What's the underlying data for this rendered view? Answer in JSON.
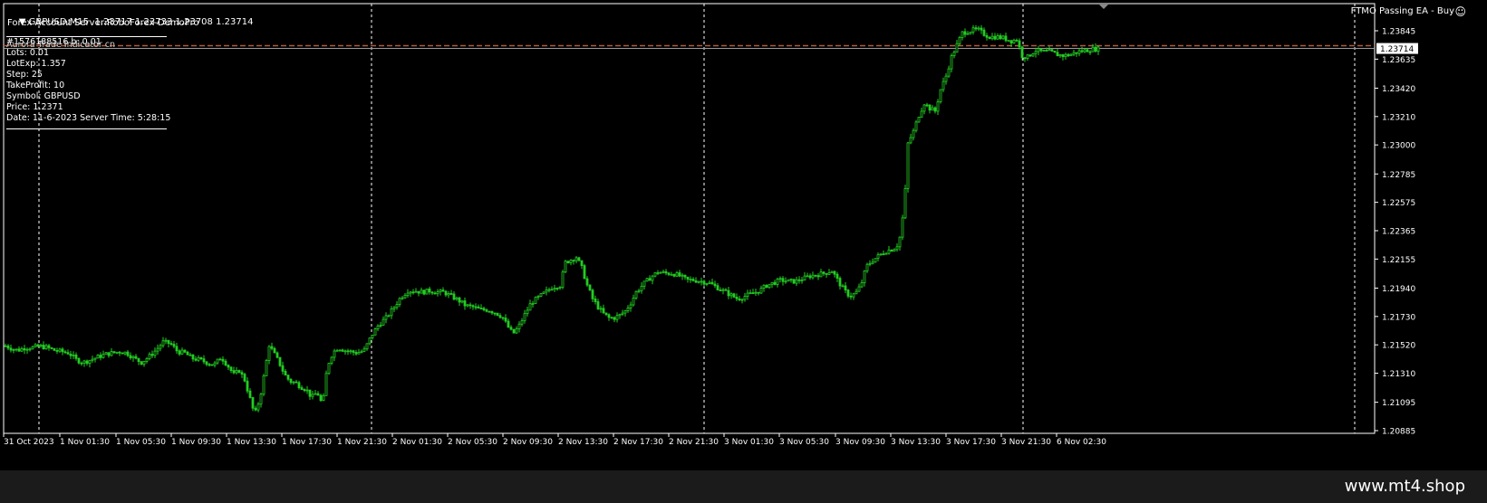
{
  "header": {
    "symbol_line": "GBPUSD,M15  1.23717 1.23733 1.23708 1.23714",
    "server_line": "Forex Account Server:RoboForex-DemoPro",
    "ea_name": "FTMO Passing EA - Buy",
    "ea_icon": "smiley-icon"
  },
  "info_panel": {
    "overlay_text": "#1576188516 b: 0.01",
    "overlay_text_2": "Aurora Trade Indicator cn",
    "lines": [
      "Lots:  0.01",
      "LotExp:  1.357",
      "Step: 25",
      "TakeProfit: 10",
      "Symbol: GBPUSD",
      "Price:  1.2371",
      "Date: 11-6-2023 Server Time: 5:28:15"
    ]
  },
  "watermark": "www.mt4.shop",
  "colors": {
    "background": "#000000",
    "candles": "#22cc22",
    "axis": "#ffffff",
    "grid": "#ffffff",
    "order_line": "#b05a3c"
  },
  "chart_data": {
    "type": "candlestick",
    "symbol": "GBPUSD",
    "timeframe": "M15",
    "current_price": "1.23714",
    "y_ticks": [
      "1.23845",
      "1.23635",
      "1.23420",
      "1.23210",
      "1.23000",
      "1.22785",
      "1.22575",
      "1.22365",
      "1.22155",
      "1.21940",
      "1.21730",
      "1.21520",
      "1.21310",
      "1.21095",
      "1.20885"
    ],
    "ylim": [
      1.20885,
      1.23845
    ],
    "x_ticks": [
      "31 Oct 2023",
      "1 Nov 01:30",
      "1 Nov 05:30",
      "1 Nov 09:30",
      "1 Nov 13:30",
      "1 Nov 17:30",
      "1 Nov 21:30",
      "2 Nov 01:30",
      "2 Nov 05:30",
      "2 Nov 09:30",
      "2 Nov 13:30",
      "2 Nov 17:30",
      "2 Nov 21:30",
      "3 Nov 01:30",
      "3 Nov 05:30",
      "3 Nov 09:30",
      "3 Nov 13:30",
      "3 Nov 17:30",
      "3 Nov 21:30",
      "6 Nov 02:30"
    ],
    "period_separators": 5,
    "close_path": [
      [
        0,
        1.2153
      ],
      [
        14,
        1.2149
      ],
      [
        20,
        1.2148
      ],
      [
        28,
        1.215
      ],
      [
        36,
        1.215
      ],
      [
        44,
        1.2151
      ],
      [
        52,
        1.215
      ],
      [
        60,
        1.2148
      ],
      [
        68,
        1.2147
      ],
      [
        76,
        1.2146
      ],
      [
        84,
        1.2141
      ],
      [
        92,
        1.2139
      ],
      [
        100,
        1.2141
      ],
      [
        108,
        1.2143
      ],
      [
        116,
        1.2145
      ],
      [
        124,
        1.2146
      ],
      [
        132,
        1.2147
      ],
      [
        140,
        1.2146
      ],
      [
        148,
        1.2142
      ],
      [
        156,
        1.2139
      ],
      [
        164,
        1.2143
      ],
      [
        172,
        1.2148
      ],
      [
        180,
        1.2154
      ],
      [
        188,
        1.2153
      ],
      [
        196,
        1.2147
      ],
      [
        204,
        1.2146
      ],
      [
        212,
        1.2142
      ],
      [
        220,
        1.2141
      ],
      [
        228,
        1.2139
      ],
      [
        236,
        1.2137
      ],
      [
        244,
        1.2143
      ],
      [
        252,
        1.2136
      ],
      [
        258,
        1.213
      ],
      [
        264,
        1.2133
      ],
      [
        270,
        1.2126
      ],
      [
        276,
        1.2112
      ],
      [
        281,
        1.21
      ],
      [
        287,
        1.2113
      ],
      [
        292,
        1.2132
      ],
      [
        297,
        1.2152
      ],
      [
        302,
        1.2146
      ],
      [
        308,
        1.2139
      ],
      [
        314,
        1.213
      ],
      [
        320,
        1.2125
      ],
      [
        326,
        1.2124
      ],
      [
        332,
        1.2121
      ],
      [
        338,
        1.2119
      ],
      [
        344,
        1.2113
      ],
      [
        350,
        1.2117
      ],
      [
        356,
        1.2107
      ],
      [
        361,
        1.2136
      ],
      [
        367,
        1.2146
      ],
      [
        373,
        1.215
      ],
      [
        380,
        1.2148
      ],
      [
        387,
        1.2147
      ],
      [
        394,
        1.2146
      ],
      [
        402,
        1.2148
      ],
      [
        410,
        1.2159
      ],
      [
        418,
        1.2167
      ],
      [
        426,
        1.2172
      ],
      [
        434,
        1.2179
      ],
      [
        442,
        1.2187
      ],
      [
        450,
        1.2192
      ],
      [
        458,
        1.2192
      ],
      [
        466,
        1.2191
      ],
      [
        474,
        1.2192
      ],
      [
        482,
        1.2191
      ],
      [
        490,
        1.2191
      ],
      [
        498,
        1.2188
      ],
      [
        506,
        1.2185
      ],
      [
        514,
        1.2181
      ],
      [
        522,
        1.218
      ],
      [
        530,
        1.2178
      ],
      [
        538,
        1.2178
      ],
      [
        546,
        1.2176
      ],
      [
        554,
        1.2173
      ],
      [
        560,
        1.2166
      ],
      [
        566,
        1.216
      ],
      [
        572,
        1.2165
      ],
      [
        578,
        1.2173
      ],
      [
        586,
        1.2183
      ],
      [
        594,
        1.2187
      ],
      [
        602,
        1.2191
      ],
      [
        610,
        1.2195
      ],
      [
        618,
        1.2196
      ],
      [
        624,
        1.2213
      ],
      [
        630,
        1.2215
      ],
      [
        636,
        1.2217
      ],
      [
        642,
        1.2209
      ],
      [
        648,
        1.2196
      ],
      [
        654,
        1.2186
      ],
      [
        660,
        1.218
      ],
      [
        666,
        1.2175
      ],
      [
        672,
        1.2172
      ],
      [
        678,
        1.2172
      ],
      [
        684,
        1.2174
      ],
      [
        690,
        1.2177
      ],
      [
        696,
        1.2183
      ],
      [
        702,
        1.2191
      ],
      [
        710,
        1.2197
      ],
      [
        718,
        1.2202
      ],
      [
        726,
        1.2206
      ],
      [
        734,
        1.2205
      ],
      [
        742,
        1.2205
      ],
      [
        750,
        1.2203
      ],
      [
        758,
        1.22
      ],
      [
        766,
        1.22
      ],
      [
        774,
        1.2199
      ],
      [
        782,
        1.2198
      ],
      [
        790,
        1.2195
      ],
      [
        798,
        1.2192
      ],
      [
        806,
        1.2189
      ],
      [
        814,
        1.2186
      ],
      [
        822,
        1.2188
      ],
      [
        830,
        1.219
      ],
      [
        838,
        1.2192
      ],
      [
        846,
        1.2196
      ],
      [
        854,
        1.2198
      ],
      [
        862,
        1.22
      ],
      [
        870,
        1.2199
      ],
      [
        878,
        1.2199
      ],
      [
        886,
        1.2201
      ],
      [
        894,
        1.2203
      ],
      [
        902,
        1.2204
      ],
      [
        910,
        1.2205
      ],
      [
        918,
        1.2207
      ],
      [
        926,
        1.2198
      ],
      [
        932,
        1.2192
      ],
      [
        938,
        1.2188
      ],
      [
        944,
        1.219
      ],
      [
        950,
        1.2196
      ],
      [
        956,
        1.221
      ],
      [
        962,
        1.2214
      ],
      [
        968,
        1.2217
      ],
      [
        974,
        1.222
      ],
      [
        980,
        1.2222
      ],
      [
        986,
        1.2223
      ],
      [
        992,
        1.2227
      ],
      [
        998,
        1.2255
      ],
      [
        1002,
        1.2301
      ],
      [
        1008,
        1.231
      ],
      [
        1014,
        1.2322
      ],
      [
        1020,
        1.2331
      ],
      [
        1026,
        1.2327
      ],
      [
        1032,
        1.2325
      ],
      [
        1038,
        1.2341
      ],
      [
        1044,
        1.2351
      ],
      [
        1050,
        1.2365
      ],
      [
        1056,
        1.2374
      ],
      [
        1062,
        1.2383
      ],
      [
        1068,
        1.2384
      ],
      [
        1074,
        1.2385
      ],
      [
        1080,
        1.2385
      ],
      [
        1086,
        1.2382
      ],
      [
        1092,
        1.238
      ],
      [
        1100,
        1.238
      ],
      [
        1108,
        1.2379
      ],
      [
        1116,
        1.2377
      ],
      [
        1122,
        1.2378
      ],
      [
        1128,
        1.2366
      ],
      [
        1134,
        1.2365
      ],
      [
        1142,
        1.237
      ],
      [
        1150,
        1.2369
      ],
      [
        1158,
        1.2369
      ],
      [
        1166,
        1.2367
      ],
      [
        1174,
        1.2366
      ],
      [
        1182,
        1.2367
      ],
      [
        1190,
        1.2369
      ],
      [
        1198,
        1.237
      ],
      [
        1206,
        1.2371
      ],
      [
        1212,
        1.2371
      ]
    ]
  }
}
